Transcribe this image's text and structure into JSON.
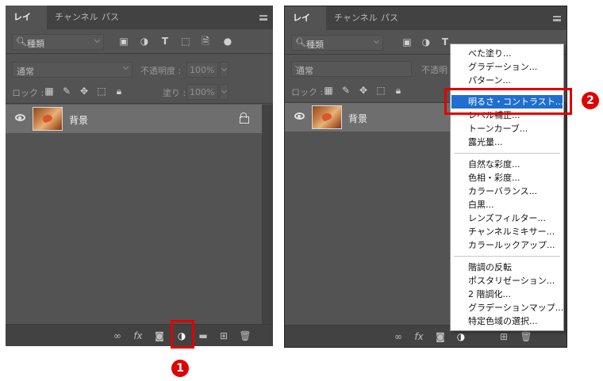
{
  "panel_left": {
    "tabs": [
      "レイヤー",
      "チャンネル",
      "パス"
    ],
    "filter": {
      "label": "種類"
    },
    "blend_mode": "通常",
    "opacity_label": "不透明度 :",
    "opacity_value": "100%",
    "lock_label": "ロック :",
    "fill_label": "塗り :",
    "fill_value": "100%",
    "layer": {
      "name": "背景"
    },
    "footer_fx": "fx"
  },
  "panel_right": {
    "tabs": [
      "レイヤー",
      "チャンネル",
      "パス"
    ],
    "filter": {
      "label": "種類"
    },
    "blend_mode": "通常",
    "opacity_label": "不透明",
    "lock_label": "ロック :",
    "layer": {
      "name": "背景"
    },
    "footer_fx": "fx"
  },
  "adjustment_menu": {
    "group1": [
      "べた塗り...",
      "グラデーション...",
      "パターン..."
    ],
    "group2": [
      "明るさ・コントラスト...",
      "レベル補正...",
      "トーンカーブ...",
      "露光量..."
    ],
    "group3": [
      "自然な彩度...",
      "色相・彩度...",
      "カラーバランス...",
      "白黒...",
      "レンズフィルター...",
      "チャンネルミキサー...",
      "カラールックアップ..."
    ],
    "group4": [
      "階調の反転",
      "ポスタリゼーション...",
      "2 階調化...",
      "グラデーションマップ...",
      "特定色域の選択..."
    ],
    "selected": "明るさ・コントラスト..."
  },
  "callouts": {
    "step1": "1",
    "step2": "2"
  },
  "colors": {
    "panel": "#535353",
    "highlight": "#1e6fd0",
    "callout": "#e00000"
  }
}
